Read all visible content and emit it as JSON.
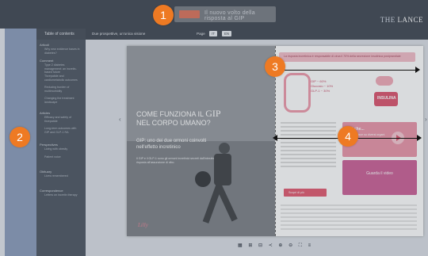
{
  "top_bar": {
    "ad_text": "Il nuovo volto della risposta al GIP",
    "brand_prefix": "THE ",
    "brand_name": "LANCE"
  },
  "toc": {
    "title": "Table of contents",
    "sections": [
      {
        "label": "Articoli",
        "items": [
          "Why new evidence bases in diabetes?"
        ]
      },
      {
        "label": "Comment",
        "items": [
          "Type 2 diabetes management: an incretin-based future",
          "Tirzepatide and cardiometabolic outcomes",
          "Reducing burden of multimorbidity",
          "Changing the treatment landscape"
        ]
      },
      {
        "label": "Articles",
        "items": [
          "Efficacy and safety of tirzepatide",
          "Long-term outcomes with GIP and GLP-1 RA"
        ]
      },
      {
        "label": "Perspectives",
        "items": [
          "Living with obesity",
          "Patient voice"
        ]
      },
      {
        "label": "Obituary",
        "items": [
          "Lives remembered"
        ]
      },
      {
        "label": "Correspondence",
        "items": [
          "Letters on incretin therapy"
        ]
      }
    ]
  },
  "viewer_bar": {
    "label": "Due prospettive, un'unica visione",
    "page_label": "Page",
    "page_buttons": [
      "IT",
      "EN"
    ]
  },
  "page": {
    "title_line1": "COME FUNZIONA IL",
    "title_gip": "GIP",
    "title_line2": "NEL CORPO UMANO?",
    "subtitle": "GIP: uno dei due ormoni coinvolti nell'effetto incretinico",
    "body": "Il GIP e il GLP-1 sono gli ormoni incretinici secreti dall'intestino in risposta all'assunzione di cibo.",
    "logo": "Lilly",
    "banner": "La risposta incretinica è responsabile di circa il 70% della secrezione insulinica postprandiale",
    "gut_labels": [
      "GIP ~ 60%",
      "Glucosio ~ 10%",
      "GLP-1 ~ 30%"
    ],
    "hex_label": "INSULINA",
    "pinkbox_title": "Sai che...",
    "pinkbox_text": "il GIP agisce su diversi organi del corpo",
    "video_text": "Guarda il video",
    "cta": "Scopri di più"
  },
  "controls": {
    "glyphs": "▦ ⊞ ⊟  ≺  ⊕ ⊖ ⛶  ≡"
  },
  "callouts": {
    "badge1": "1",
    "badge2": "2",
    "badge3": "3",
    "badge4": "4",
    "color": "#ee7a23"
  }
}
